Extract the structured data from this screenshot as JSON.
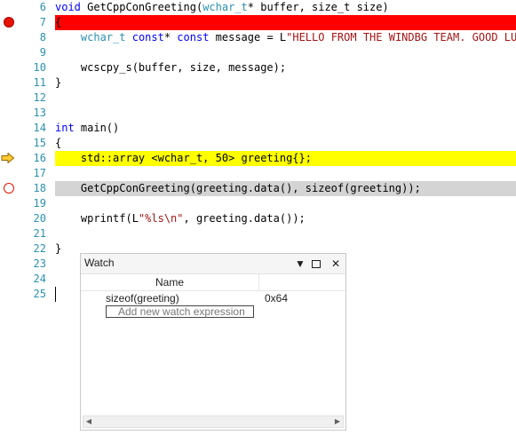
{
  "editor": {
    "lines": [
      {
        "num": "6",
        "tokens": [
          [
            "kw",
            "void"
          ],
          [
            "p",
            " GetCppConGreeting("
          ],
          [
            "ty",
            "wchar_t"
          ],
          [
            "p",
            "* buffer, size_t size)"
          ]
        ]
      },
      {
        "num": "7",
        "tokens": [
          [
            "p",
            "{"
          ]
        ]
      },
      {
        "num": "8",
        "tokens": [
          [
            "p",
            "    "
          ],
          [
            "ty",
            "wchar_t"
          ],
          [
            "p",
            " "
          ],
          [
            "kw",
            "const"
          ],
          [
            "p",
            "* "
          ],
          [
            "kw",
            "const"
          ],
          [
            "p",
            " message = L"
          ],
          [
            "str",
            "\"HELLO FROM THE WINDBG TEAM. GOOD LUCK"
          ]
        ]
      },
      {
        "num": "9",
        "tokens": []
      },
      {
        "num": "10",
        "tokens": [
          [
            "p",
            "    wcscpy_s(buffer, size, message);"
          ]
        ]
      },
      {
        "num": "11",
        "tokens": [
          [
            "p",
            "}"
          ]
        ]
      },
      {
        "num": "12",
        "tokens": []
      },
      {
        "num": "13",
        "tokens": []
      },
      {
        "num": "14",
        "tokens": [
          [
            "kw",
            "int"
          ],
          [
            "p",
            " main()"
          ]
        ]
      },
      {
        "num": "15",
        "tokens": [
          [
            "p",
            "{"
          ]
        ]
      },
      {
        "num": "16",
        "tokens": [
          [
            "p",
            "    std::array <wchar_t, 50> greeting{};"
          ]
        ]
      },
      {
        "num": "17",
        "tokens": []
      },
      {
        "num": "18",
        "tokens": [
          [
            "p",
            "    GetCppConGreeting(greeting.data(), sizeof(greeting));"
          ]
        ]
      },
      {
        "num": "19",
        "tokens": []
      },
      {
        "num": "20",
        "tokens": [
          [
            "p",
            "    wprintf(L"
          ],
          [
            "str",
            "\"%ls\\n\""
          ],
          [
            "p",
            ", greeting.data());"
          ]
        ]
      },
      {
        "num": "21",
        "tokens": []
      },
      {
        "num": "22",
        "tokens": [
          [
            "p",
            "}"
          ]
        ]
      },
      {
        "num": "23",
        "tokens": []
      },
      {
        "num": "24",
        "tokens": []
      },
      {
        "num": "25",
        "tokens": []
      }
    ],
    "line_states": {
      "7": {
        "highlight": "#ff0000",
        "glyph": "breakpoint-hit-icon"
      },
      "16": {
        "highlight": "#ffff00",
        "glyph": "current-statement-arrow-icon"
      },
      "18": {
        "highlight": "#d4d4d4",
        "glyph": "breakpoint-disabled-icon"
      }
    },
    "colors": {
      "keyword": "#0000ff",
      "type": "#2b91af",
      "string": "#a31515",
      "line_number": "#2b91af"
    }
  },
  "watch": {
    "title": "Watch",
    "dropdown_icon": "caret-down-icon",
    "maximize_icon": "maximize-icon",
    "close_icon": "close-icon",
    "column_name": "Name",
    "rows": [
      {
        "name": "sizeof(greeting)",
        "value": "0x64"
      }
    ],
    "add_placeholder": "Add new watch expression"
  }
}
